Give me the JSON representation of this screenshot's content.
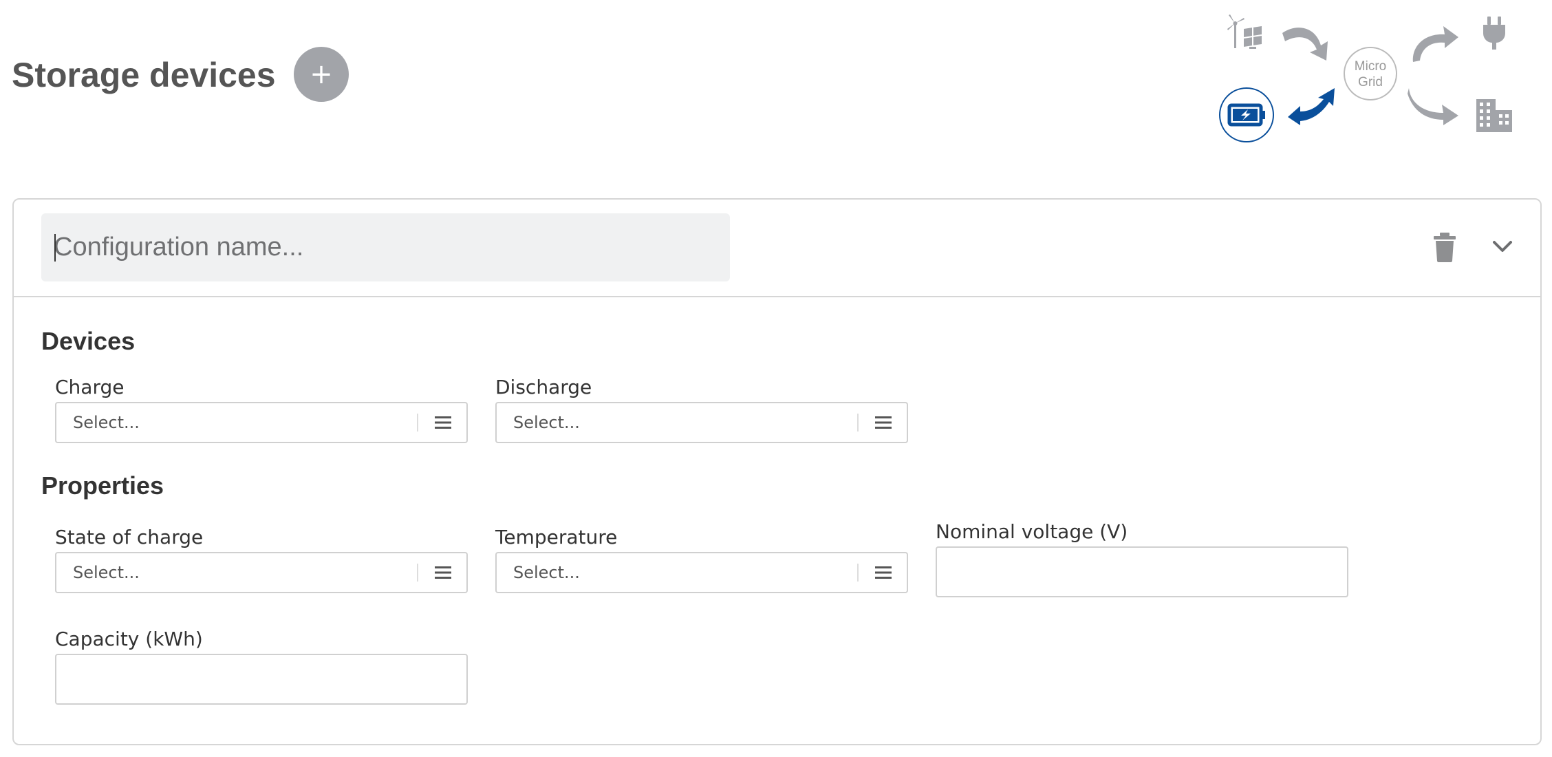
{
  "header": {
    "title": "Storage devices",
    "add_label": "+"
  },
  "microgrid": {
    "center_line1": "Micro",
    "center_line2": "Grid",
    "active_node": "storage",
    "colors": {
      "active": "#0a4f9b",
      "inactive": "#a2a4a9"
    },
    "icons": [
      "wind-solar-icon",
      "plug-icon",
      "battery-icon",
      "building-icon"
    ]
  },
  "config": {
    "name_placeholder": "Configuration name...",
    "name_value": ""
  },
  "devices": {
    "title": "Devices",
    "charge_label": "Charge",
    "charge_value": "Select...",
    "discharge_label": "Discharge",
    "discharge_value": "Select..."
  },
  "properties": {
    "title": "Properties",
    "soc_label": "State of charge",
    "soc_value": "Select...",
    "temperature_label": "Temperature",
    "temperature_value": "Select...",
    "voltage_label": "Nominal voltage (V)",
    "voltage_value": "",
    "capacity_label": "Capacity (kWh)",
    "capacity_value": ""
  }
}
